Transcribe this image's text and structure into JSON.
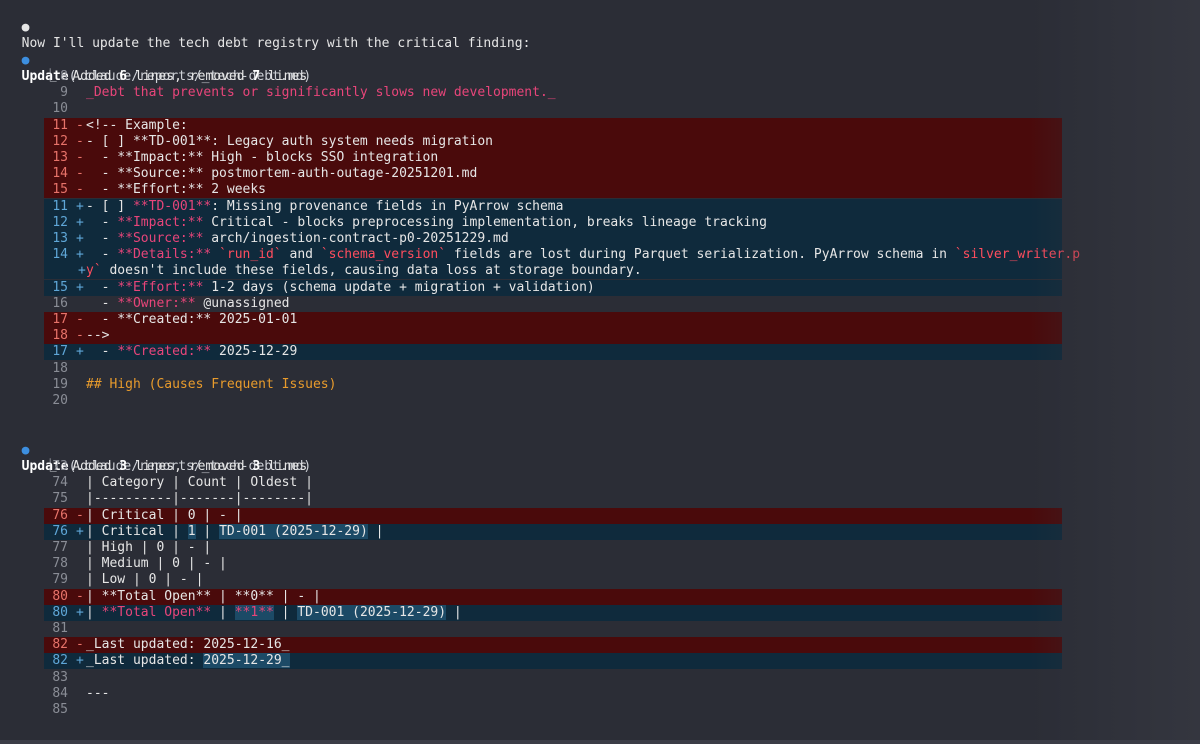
{
  "intro": "Now I'll update the tech debt registry with the critical finding:",
  "updates": [
    {
      "tool": "Update",
      "path": "(.claude/reports/_tech-debt.md)",
      "summary_pre": "Added ",
      "added": "6",
      "summary_mid": " lines, removed ",
      "removed": "7",
      "summary_post": " lines"
    },
    {
      "tool": "Update",
      "path": "(.claude/reports/_tech-debt.md)",
      "summary_pre": "Added ",
      "added": "3",
      "summary_mid": " lines, removed ",
      "removed": "3",
      "summary_post": " lines"
    }
  ],
  "diff1": [
    {
      "type": "ctx",
      "n": "8",
      "segs": []
    },
    {
      "type": "ctx",
      "n": "9",
      "segs": [
        {
          "t": "_Debt that prevents or significantly slows new development._",
          "c": "pink"
        }
      ]
    },
    {
      "type": "ctx",
      "n": "10",
      "segs": []
    },
    {
      "type": "del",
      "n": "11",
      "segs": [
        {
          "t": "<!-- Example:"
        }
      ]
    },
    {
      "type": "del",
      "n": "12",
      "segs": [
        {
          "t": "- [ ] **TD-001**: Legacy auth system needs migration"
        }
      ]
    },
    {
      "type": "del",
      "n": "13",
      "segs": [
        {
          "t": "  - **Impact:** High - blocks SSO integration"
        }
      ]
    },
    {
      "type": "del",
      "n": "14",
      "segs": [
        {
          "t": "  - **Source:** postmortem-auth-outage-20251201.md"
        }
      ]
    },
    {
      "type": "del",
      "n": "15",
      "segs": [
        {
          "t": "  - **Effort:** 2 weeks"
        }
      ]
    },
    {
      "type": "add",
      "n": "11",
      "segs": [
        {
          "t": "- [ ] "
        },
        {
          "t": "**TD-001**",
          "c": "pink"
        },
        {
          "t": ": Missing provenance fields in PyArrow schema"
        }
      ]
    },
    {
      "type": "add",
      "n": "12",
      "segs": [
        {
          "t": "  - "
        },
        {
          "t": "**Impact:**",
          "c": "pink"
        },
        {
          "t": " Critical - blocks preprocessing implementation, breaks lineage tracking"
        }
      ]
    },
    {
      "type": "add",
      "n": "13",
      "segs": [
        {
          "t": "  - "
        },
        {
          "t": "**Source:**",
          "c": "pink"
        },
        {
          "t": " arch/ingestion-contract-p0-20251229.md"
        }
      ]
    },
    {
      "type": "add",
      "n": "14",
      "segs": [
        {
          "t": "  - "
        },
        {
          "t": "**Details:**",
          "c": "pink"
        },
        {
          "t": " "
        },
        {
          "t": "`run_id`",
          "c": "red"
        },
        {
          "t": " and "
        },
        {
          "t": "`schema_version`",
          "c": "red"
        },
        {
          "t": " fields are lost during Parquet serialization. PyArrow schema in "
        },
        {
          "t": "`silver_writer.p",
          "c": "red"
        }
      ]
    },
    {
      "type": "wrap",
      "n": "",
      "segs": [
        {
          "t": "y`",
          "c": "red"
        },
        {
          "t": " doesn't include these fields, causing data loss at storage boundary."
        }
      ]
    },
    {
      "type": "add",
      "n": "15",
      "segs": [
        {
          "t": "  - "
        },
        {
          "t": "**Effort:**",
          "c": "pink"
        },
        {
          "t": " 1-2 days (schema update + migration + validation)"
        }
      ]
    },
    {
      "type": "ctx",
      "n": "16",
      "segs": [
        {
          "t": "  - "
        },
        {
          "t": "**Owner:**",
          "c": "pink"
        },
        {
          "t": " @unassigned"
        }
      ]
    },
    {
      "type": "del",
      "n": "17",
      "segs": [
        {
          "t": "  - **Created:** 2025-01-01"
        }
      ]
    },
    {
      "type": "del",
      "n": "18",
      "segs": [
        {
          "t": "-->"
        }
      ]
    },
    {
      "type": "add",
      "n": "17",
      "segs": [
        {
          "t": "  - "
        },
        {
          "t": "**Created:**",
          "c": "pink"
        },
        {
          "t": " 2025-12-29"
        }
      ]
    },
    {
      "type": "ctx",
      "n": "18",
      "segs": []
    },
    {
      "type": "ctx",
      "n": "19",
      "segs": [
        {
          "t": "## High (Causes Frequent Issues)",
          "c": "orange"
        }
      ]
    },
    {
      "type": "ctx",
      "n": "20",
      "segs": []
    }
  ],
  "diff2": [
    {
      "type": "ctx",
      "n": "73",
      "segs": []
    },
    {
      "type": "ctx",
      "n": "74",
      "segs": [
        {
          "t": "| Category | Count | Oldest |"
        }
      ]
    },
    {
      "type": "ctx",
      "n": "75",
      "segs": [
        {
          "t": "|----------|-------|--------|"
        }
      ]
    },
    {
      "type": "del",
      "n": "76",
      "segs": [
        {
          "t": "| Critical | 0 | - |"
        }
      ]
    },
    {
      "type": "add",
      "n": "76",
      "segs": [
        {
          "t": "| Critical | "
        },
        {
          "t": "1",
          "h": 1
        },
        {
          "t": " | "
        },
        {
          "t": "TD-001 (2025-12-29)",
          "h": 1
        },
        {
          "t": " |"
        }
      ]
    },
    {
      "type": "ctx",
      "n": "77",
      "segs": [
        {
          "t": "| High | 0 | - |"
        }
      ]
    },
    {
      "type": "ctx",
      "n": "78",
      "segs": [
        {
          "t": "| Medium | 0 | - |"
        }
      ]
    },
    {
      "type": "ctx",
      "n": "79",
      "segs": [
        {
          "t": "| Low | 0 | - |"
        }
      ]
    },
    {
      "type": "del",
      "n": "80",
      "segs": [
        {
          "t": "| **Total Open** | **0** | - |"
        }
      ]
    },
    {
      "type": "add",
      "n": "80",
      "segs": [
        {
          "t": "| "
        },
        {
          "t": "**Total Open**",
          "c": "pink"
        },
        {
          "t": " | "
        },
        {
          "t": "**1**",
          "c": "pink",
          "h": 1
        },
        {
          "t": " | "
        },
        {
          "t": "TD-001 (2025-12-29)",
          "h": 1
        },
        {
          "t": " |"
        }
      ]
    },
    {
      "type": "ctx",
      "n": "81",
      "segs": []
    },
    {
      "type": "del",
      "n": "82",
      "segs": [
        {
          "t": "_Last updated: 2025-12-16_"
        }
      ]
    },
    {
      "type": "add",
      "n": "82",
      "segs": [
        {
          "t": "_Last updated: "
        },
        {
          "t": "2025-12-29_",
          "h": 1
        }
      ]
    },
    {
      "type": "ctx",
      "n": "83",
      "segs": []
    },
    {
      "type": "ctx",
      "n": "84",
      "segs": [
        {
          "t": "---"
        }
      ]
    },
    {
      "type": "ctx",
      "n": "85",
      "segs": []
    }
  ]
}
